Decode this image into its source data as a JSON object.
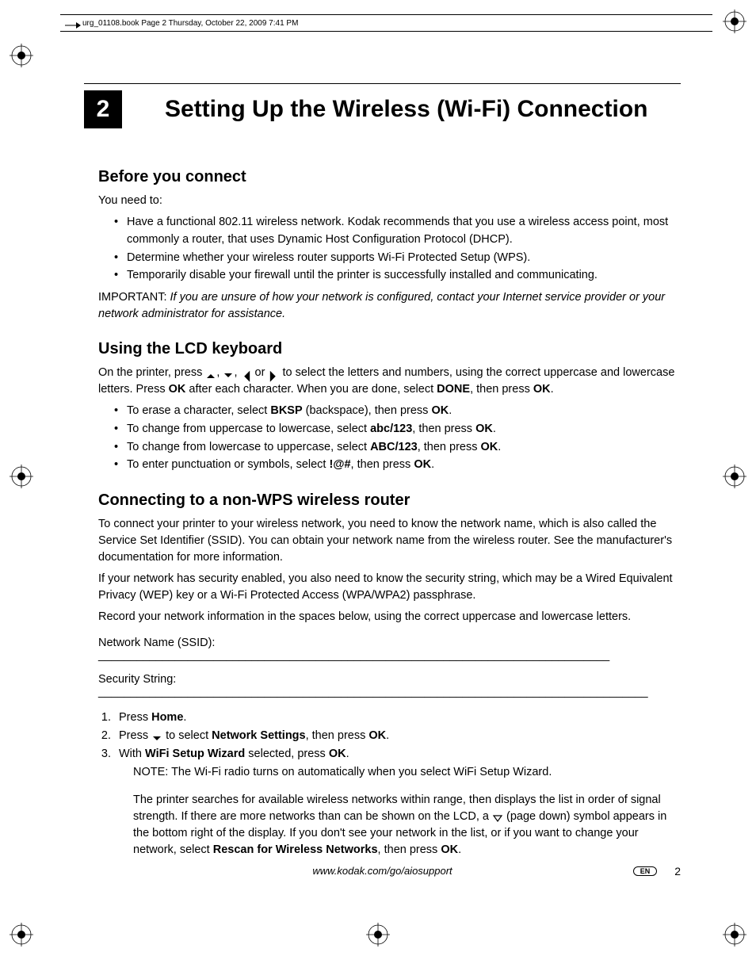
{
  "header": {
    "file_info": "urg_01108.book  Page 2  Thursday, October 22, 2009  7:41 PM"
  },
  "chapter": {
    "number": "2",
    "title": "Setting Up the Wireless (Wi-Fi) Connection"
  },
  "sections": {
    "before": {
      "title": "Before you connect",
      "intro": "You need to:",
      "bullets": [
        "Have a functional 802.11 wireless network. Kodak recommends that you use a wireless access point, most commonly a router, that uses Dynamic Host Configuration Protocol (DHCP).",
        "Determine whether your wireless router supports Wi-Fi Protected Setup (WPS).",
        "Temporarily disable your firewall until the printer is successfully installed and communicating."
      ],
      "important_label": "IMPORTANT:",
      "important_text": "If you are unsure of how your network is configured, contact your Internet service provider or your network administrator for assistance."
    },
    "lcd": {
      "title": "Using the LCD keyboard",
      "intro_pre": "On the printer, press ",
      "intro_mid1": ", ",
      "intro_mid2": ", ",
      "intro_mid3": " or ",
      "intro_post": " to select the letters and numbers, using the correct uppercase and lowercase letters. Press ",
      "ok1": "OK",
      "intro_post2": " after each character. When you are done, select ",
      "done": "DONE",
      "intro_post3": ", then press ",
      "ok2": "OK",
      "period": ".",
      "bullets": [
        {
          "pre": "To erase a character, select ",
          "b1": "BKSP",
          "mid": " (backspace), then press ",
          "b2": "OK",
          "post": "."
        },
        {
          "pre": "To change from uppercase to lowercase, select ",
          "b1": "abc/123",
          "mid": ", then press ",
          "b2": "OK",
          "post": "."
        },
        {
          "pre": "To change from lowercase to uppercase, select ",
          "b1": "ABC/123",
          "mid": ", then press ",
          "b2": "OK",
          "post": "."
        },
        {
          "pre": "To enter punctuation or symbols, select ",
          "b1": "!@#",
          "mid": ", then press ",
          "b2": "OK",
          "post": "."
        }
      ]
    },
    "nonwps": {
      "title": "Connecting to a non-WPS wireless router",
      "p1": "To connect your printer to your wireless network, you need to know the network name, which is also called the Service Set Identifier (SSID). You can obtain your network name from the wireless router. See the manufacturer's documentation for more information.",
      "p2": "If your network has security enabled, you also need to know the security string, which may be a Wired Equivalent Privacy (WEP) key or a Wi-Fi Protected Access (WPA/WPA2) passphrase.",
      "p3": "Record your network information in the spaces below, using the correct uppercase and lowercase letters.",
      "field_ssid": "Network Name (SSID): ________________________________________________________________________________",
      "field_sec": "Security String: ______________________________________________________________________________________",
      "step1_pre": "Press ",
      "step1_b": "Home",
      "step1_post": ".",
      "step2_pre": "Press ",
      "step2_mid": " to select ",
      "step2_b": "Network Settings",
      "step2_mid2": ", then press ",
      "step2_b2": "OK",
      "step2_post": ".",
      "step3_pre": "With ",
      "step3_b": "WiFi Setup Wizard",
      "step3_mid": " selected, press ",
      "step3_b2": "OK",
      "step3_post": ".",
      "note": "NOTE: The Wi-Fi radio turns on automatically when you select WiFi Setup Wizard.",
      "followup_pre": "The printer searches for available wireless networks within range, then displays the list in order of signal strength. If there are more networks than can be shown on the LCD, a ",
      "followup_mid": " (page down) symbol appears in the bottom right of the display. If you don't see your network in the list, or if you want to change your network, select ",
      "followup_b": "Rescan for Wireless Networks",
      "followup_mid2": ", then press ",
      "followup_b2": "OK",
      "followup_post": "."
    }
  },
  "footer": {
    "url": "www.kodak.com/go/aiosupport",
    "lang": "EN",
    "page": "2"
  }
}
